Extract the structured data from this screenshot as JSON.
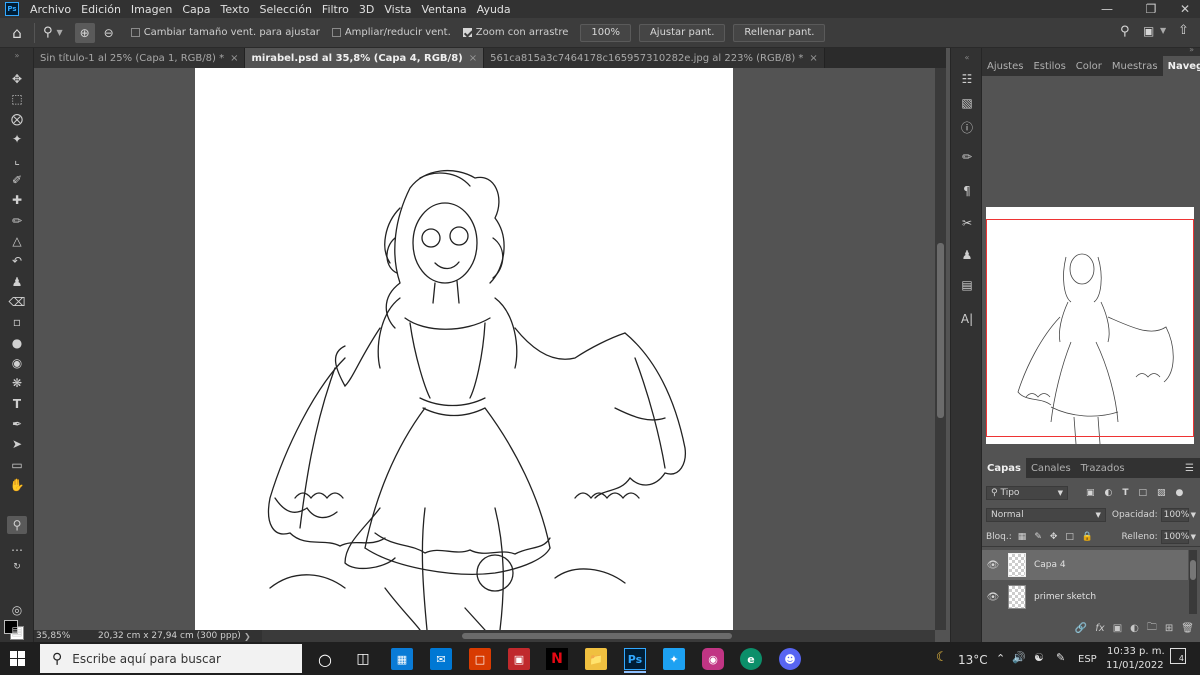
{
  "app": {
    "logo": "Ps"
  },
  "menu": [
    "Archivo",
    "Edición",
    "Imagen",
    "Capa",
    "Texto",
    "Selección",
    "Filtro",
    "3D",
    "Vista",
    "Ventana",
    "Ayuda"
  ],
  "options": {
    "resize_windows": "Cambiar tamaño vent. para ajustar",
    "zoom_all": "Ampliar/reducir vent.",
    "scrubby_zoom": "Zoom con arrastre",
    "zoom_value": "100%",
    "fit_screen": "Ajustar pant.",
    "fill_screen": "Rellenar pant."
  },
  "tabs": [
    {
      "label": "Sin título-1 al 25% (Capa 1, RGB/8) *"
    },
    {
      "label": "mirabel.psd al 35,8% (Capa 4, RGB/8)"
    },
    {
      "label": "561ca815a3c7464178c165957310282e.jpg al 223% (RGB/8) *"
    }
  ],
  "status": {
    "zoom": "35,85%",
    "doc_size": "20,32 cm x 27,94 cm (300 ppp)"
  },
  "panel_tabs_top": [
    "Ajustes",
    "Estilos",
    "Color",
    "Muestras",
    "Navegador"
  ],
  "panel_tabs_layers": [
    "Capas",
    "Canales",
    "Trazados"
  ],
  "layers_panel": {
    "filter": "Tipo",
    "blend_mode": "Normal",
    "opacity_label": "Opacidad:",
    "opacity": "100%",
    "lock_label": "Bloq.:",
    "fill_label": "Relleno:",
    "fill": "100%",
    "layers": [
      {
        "name": "Capa 4"
      },
      {
        "name": "primer sketch"
      }
    ]
  },
  "taskbar": {
    "search_placeholder": "Escribe aquí para buscar",
    "weather": "13°C",
    "lang": "ESP",
    "time": "10:33 p. m.",
    "date": "11/01/2022",
    "notifications": "4"
  }
}
